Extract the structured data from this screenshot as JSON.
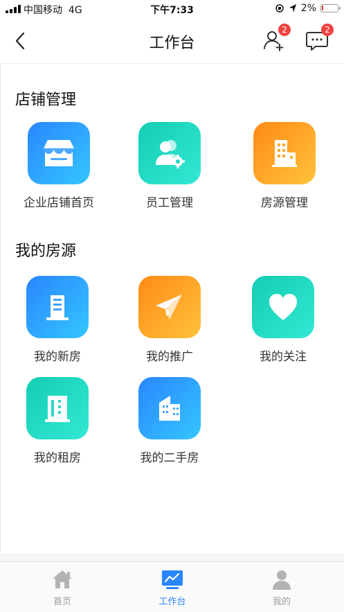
{
  "status_bar": {
    "carrier": "中国移动",
    "network": "4G",
    "time": "下午7:33",
    "battery": "2%"
  },
  "nav": {
    "title": "工作台",
    "contacts_badge": "2",
    "messages_badge": "2"
  },
  "sections": [
    {
      "title": "店铺管理",
      "items": [
        {
          "label": "企业店铺首页",
          "icon": "store-icon",
          "color": "blue"
        },
        {
          "label": "员工管理",
          "icon": "staff-settings-icon",
          "color": "teal"
        },
        {
          "label": "房源管理",
          "icon": "building-icon",
          "color": "orange"
        }
      ]
    },
    {
      "title": "我的房源",
      "items": [
        {
          "label": "我的新房",
          "icon": "new-house-icon",
          "color": "blue"
        },
        {
          "label": "我的推广",
          "icon": "paper-plane-icon",
          "color": "orange"
        },
        {
          "label": "我的关注",
          "icon": "heart-icon",
          "color": "teal"
        },
        {
          "label": "我的租房",
          "icon": "rental-building-icon",
          "color": "teal"
        },
        {
          "label": "我的二手房",
          "icon": "second-hand-house-icon",
          "color": "blue"
        }
      ]
    }
  ],
  "tabs": [
    {
      "label": "首页",
      "icon": "home-icon",
      "active": false
    },
    {
      "label": "工作台",
      "icon": "workbench-icon",
      "active": true
    },
    {
      "label": "我的",
      "icon": "user-icon",
      "active": false
    }
  ],
  "colors": {
    "accent": "#2a86ff",
    "badge": "#f0433f",
    "inactive_tab": "#9a9a9a"
  }
}
